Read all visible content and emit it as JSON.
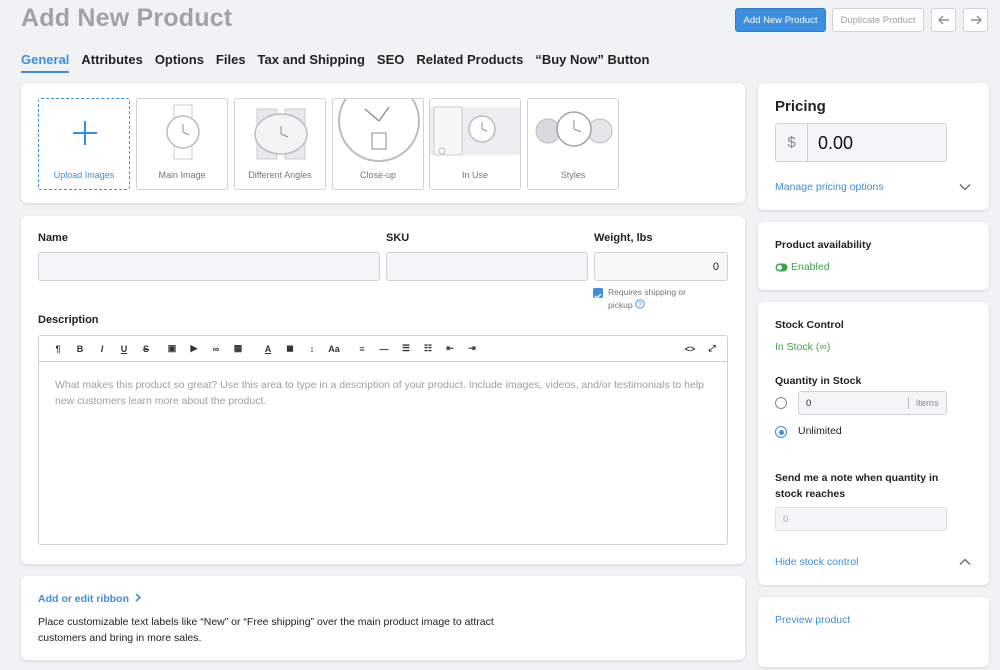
{
  "header": {
    "title": "Add New Product",
    "add_button": "Add New Product",
    "duplicate_button": "Duplicate Product"
  },
  "tabs": [
    "General",
    "Attributes",
    "Options",
    "Files",
    "Tax and Shipping",
    "SEO",
    "Related Products",
    "“Buy Now” Button"
  ],
  "images": {
    "upload_label": "Upload Images",
    "thumbs": [
      "Main Image",
      "Different Angles",
      "Close-up",
      "In Use",
      "Styles"
    ]
  },
  "form": {
    "name_label": "Name",
    "name_value": "",
    "sku_label": "SKU",
    "sku_value": "",
    "weight_label": "Weight, lbs",
    "weight_value": "0",
    "shipping_checkbox_label": "Requires shipping or pickup",
    "shipping_checked": true,
    "description_label": "Description",
    "description_placeholder": "What makes this product so great? Use this area to type in a description of your product. Include images, videos, and/or testimonials to help new customers learn more about the product."
  },
  "ribbon": {
    "link": "Add or edit ribbon",
    "text": "Place customizable text labels like “New” or “Free shipping” over the main product image to attract customers and bring in more sales."
  },
  "pricing": {
    "title": "Pricing",
    "currency": "$",
    "price": "0.00",
    "manage_link": "Manage pricing options"
  },
  "availability": {
    "label": "Product availability",
    "status": "Enabled"
  },
  "stock": {
    "control_label": "Stock Control",
    "status": "In Stock (∞)",
    "quantity_label": "Quantity in Stock",
    "quantity_value": "0",
    "quantity_unit": "items",
    "unlimited_label": "Unlimited",
    "note_label": "Send me a note when quantity in stock reaches",
    "note_value": "0",
    "hide_link": "Hide stock control"
  },
  "preview": {
    "link": "Preview product"
  },
  "colors": {
    "accent": "#3c8ee0",
    "success": "#3ea34a"
  }
}
